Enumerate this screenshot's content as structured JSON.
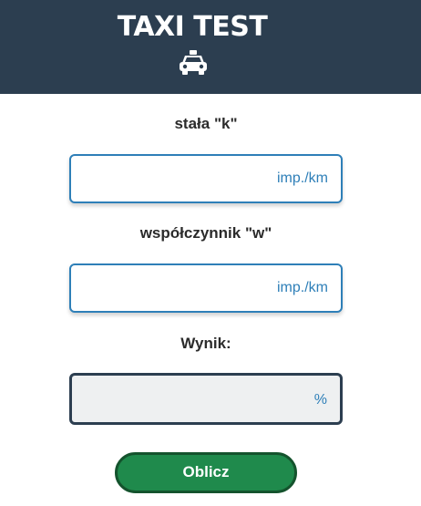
{
  "header": {
    "title": "TAXI TEST",
    "icon": "taxi-icon"
  },
  "form": {
    "k": {
      "label": "stała \"k\"",
      "value": "",
      "unit": "imp./km"
    },
    "w": {
      "label": "współczynnik \"w\"",
      "value": "",
      "unit": "imp./km"
    },
    "result": {
      "label": "Wynik:",
      "value": "",
      "unit": "%"
    },
    "button_label": "Oblicz"
  },
  "colors": {
    "header_bg": "#2c3e50",
    "input_border": "#2e7fb8",
    "unit_text": "#2e7fb8",
    "result_bg": "#eef0f1",
    "button_bg": "#1f8a4c",
    "button_border": "#14532d"
  }
}
